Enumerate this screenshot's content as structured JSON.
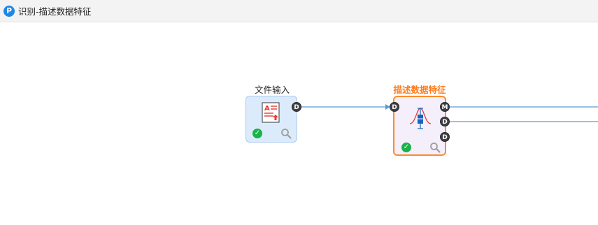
{
  "window": {
    "title": "识别-描述数据特征",
    "app_icon_letter": "P",
    "app_icon_color": "#1e88e5"
  },
  "nodes": {
    "file_input": {
      "label": "文件输入",
      "status": "success",
      "output_ports": [
        "D"
      ]
    },
    "describe_data": {
      "label": "描述数据特征",
      "label_color": "#ff7a1a",
      "status": "success",
      "input_ports": [
        "D"
      ],
      "output_ports": [
        "M",
        "D",
        "D"
      ]
    }
  },
  "colors": {
    "link": "#5b9bd5",
    "selected_border": "#ff8a2a",
    "status_ok": "#19b34a"
  }
}
